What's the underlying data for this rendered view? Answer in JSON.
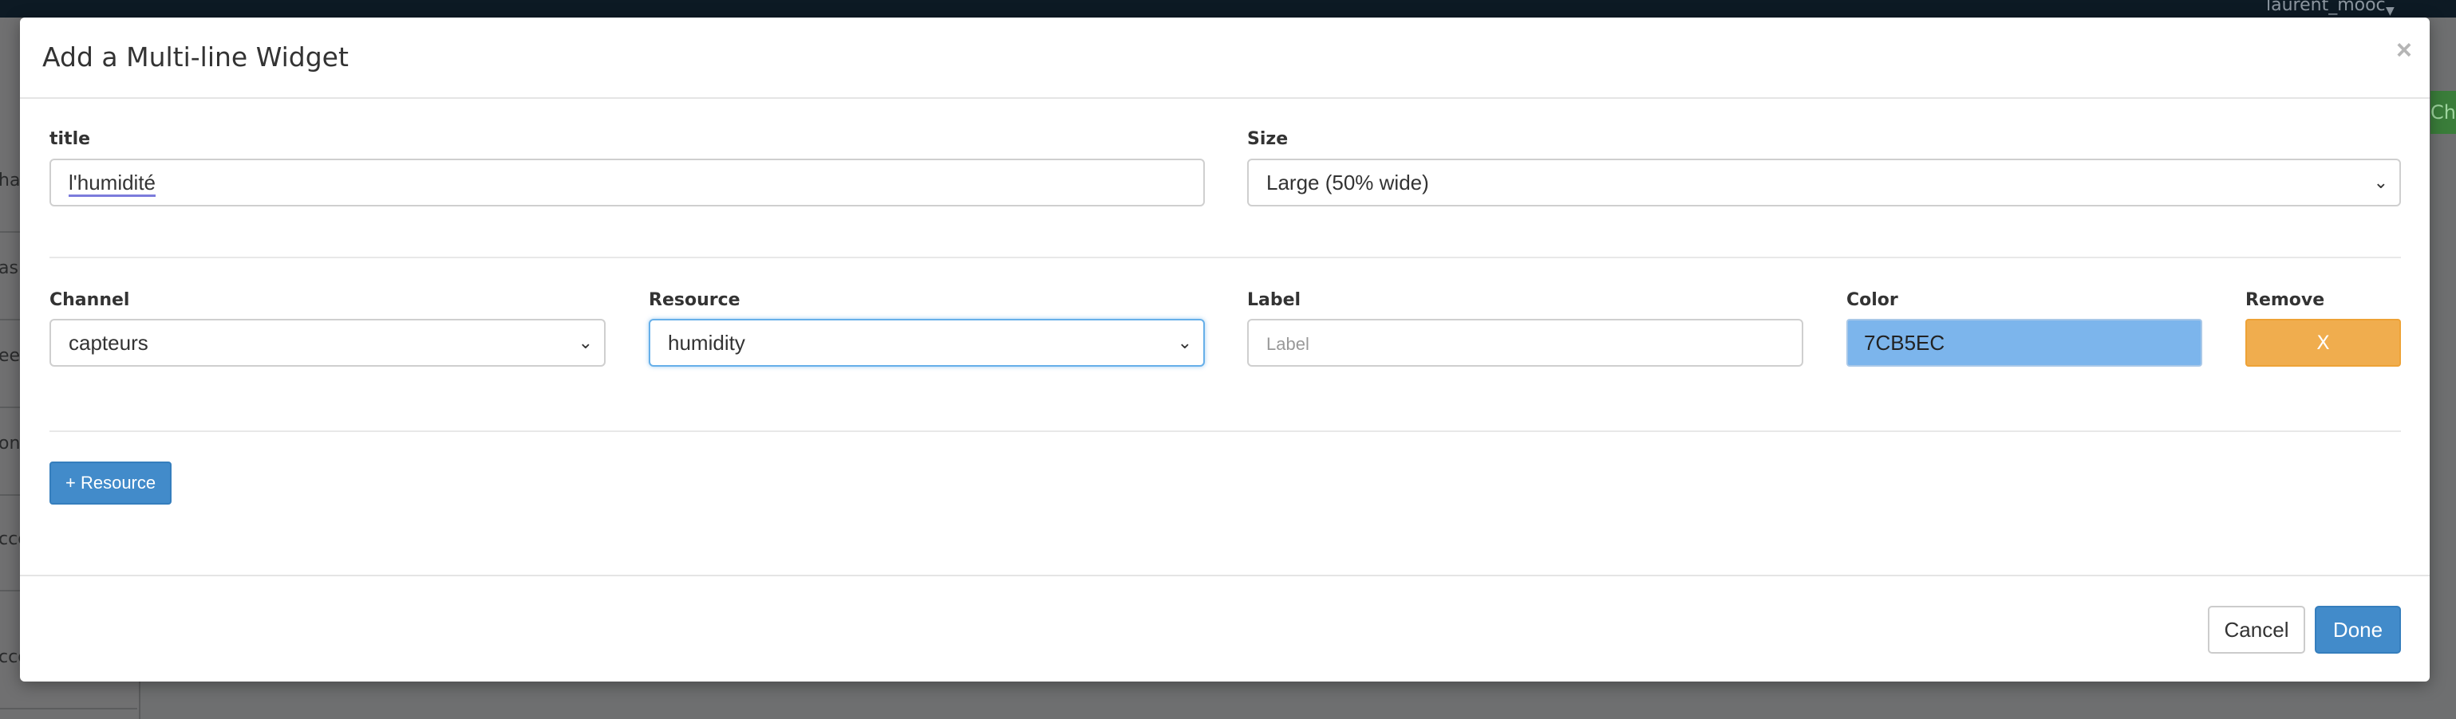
{
  "background": {
    "user_menu": "laurent_mooc",
    "sidebar_fragments": [
      "har",
      "ash",
      "een",
      "ons",
      "cco",
      "cco"
    ],
    "green_fragment": "Ch"
  },
  "modal": {
    "title": "Add a Multi-line Widget",
    "close_label": "×",
    "title_field": {
      "label": "title",
      "value": "l'humidité"
    },
    "size_field": {
      "label": "Size",
      "value": "Large (50% wide)"
    },
    "resource_row": {
      "channel": {
        "label": "Channel",
        "value": "capteurs"
      },
      "resource": {
        "label": "Resource",
        "value": "humidity"
      },
      "series_label": {
        "label": "Label",
        "placeholder": "Label"
      },
      "color": {
        "label": "Color",
        "value": "7CB5EC",
        "swatch": "#7cb5ec"
      },
      "remove": {
        "label": "Remove",
        "button": "X"
      }
    },
    "add_resource_button": "+ Resource",
    "cancel_button": "Cancel",
    "done_button": "Done"
  },
  "colors": {
    "primary": "#428bca",
    "warning": "#f0ad4e",
    "focus": "#66afe9"
  }
}
